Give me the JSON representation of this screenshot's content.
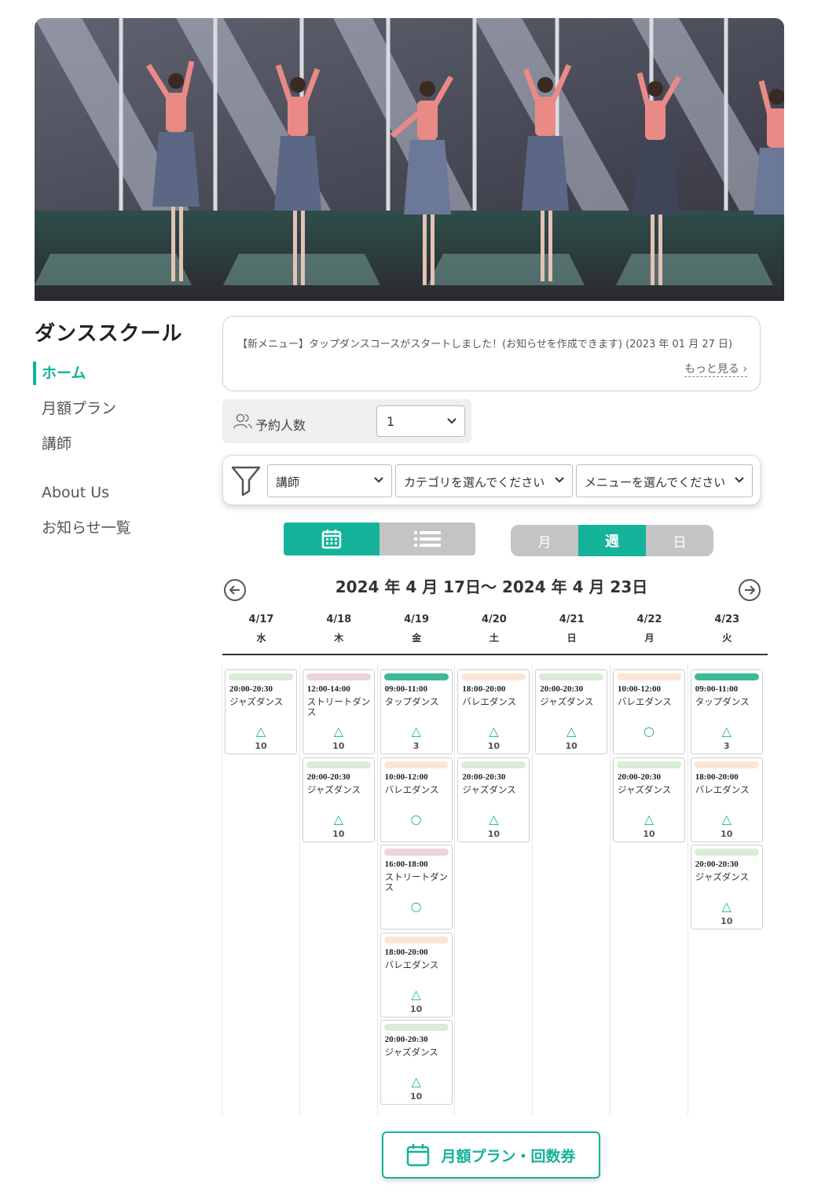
{
  "brand": {
    "title": "ダンススクール"
  },
  "nav": {
    "items": [
      {
        "label": "ホーム"
      },
      {
        "label": "月額プラン"
      },
      {
        "label": "講師"
      },
      {
        "label": "About Us"
      },
      {
        "label": "お知らせ一覧"
      }
    ]
  },
  "notice": {
    "text": "【新メニュー】タップダンスコースがスタートしました！(お知らせを作成できます) (2023 年 01 月 27 日)",
    "more_label": "もっと見る"
  },
  "booking": {
    "people_label": "予約人数",
    "people_value": "1"
  },
  "filters": {
    "instructor": "講師",
    "category": "カテゴリを選んでください",
    "menu": "メニューを選んでください"
  },
  "range_toggle": {
    "month": "月",
    "week": "週",
    "day": "日",
    "selected": "週"
  },
  "week": {
    "title": "2024 年 4 月 17日〜 2024 年 4 月 23日",
    "days": [
      {
        "date": "4/17",
        "weekday": "水",
        "lessons": [
          {
            "time": "20:00-20:30",
            "name": "ジャズダンス",
            "status": "△",
            "count": "10",
            "color": "#d8ecd6"
          }
        ]
      },
      {
        "date": "4/18",
        "weekday": "木",
        "lessons": [
          {
            "time": "12:00-14:00",
            "name": "ストリートダンス",
            "status": "△",
            "count": "10",
            "color": "#ecd3dd"
          },
          {
            "time": "20:00-20:30",
            "name": "ジャズダンス",
            "status": "△",
            "count": "10",
            "color": "#d8ecd6"
          }
        ]
      },
      {
        "date": "4/19",
        "weekday": "金",
        "lessons": [
          {
            "time": "09:00-11:00",
            "name": "タップダンス",
            "status": "△",
            "count": "3",
            "color": "#3cba96"
          },
          {
            "time": "10:00-12:00",
            "name": "バレエダンス",
            "status": "○",
            "count": "",
            "color": "#fde5d6"
          },
          {
            "time": "16:00-18:00",
            "name": "ストリートダンス",
            "status": "○",
            "count": "",
            "color": "#ecd3dd"
          },
          {
            "time": "18:00-20:00",
            "name": "バレエダンス",
            "status": "△",
            "count": "10",
            "color": "#fde5d6"
          },
          {
            "time": "20:00-20:30",
            "name": "ジャズダンス",
            "status": "△",
            "count": "10",
            "color": "#d8ecd6"
          }
        ]
      },
      {
        "date": "4/20",
        "weekday": "土",
        "lessons": [
          {
            "time": "18:00-20:00",
            "name": "バレエダンス",
            "status": "△",
            "count": "10",
            "color": "#fde5d6"
          },
          {
            "time": "20:00-20:30",
            "name": "ジャズダンス",
            "status": "△",
            "count": "10",
            "color": "#d8ecd6"
          }
        ]
      },
      {
        "date": "4/21",
        "weekday": "日",
        "lessons": [
          {
            "time": "20:00-20:30",
            "name": "ジャズダンス",
            "status": "△",
            "count": "10",
            "color": "#d8ecd6"
          }
        ]
      },
      {
        "date": "4/22",
        "weekday": "月",
        "lessons": [
          {
            "time": "10:00-12:00",
            "name": "バレエダンス",
            "status": "○",
            "count": "",
            "color": "#fde5d6"
          },
          {
            "time": "20:00-20:30",
            "name": "ジャズダンス",
            "status": "△",
            "count": "10",
            "color": "#d8ecd6"
          }
        ]
      },
      {
        "date": "4/23",
        "weekday": "火",
        "lessons": [
          {
            "time": "09:00-11:00",
            "name": "タップダンス",
            "status": "△",
            "count": "3",
            "color": "#3cba96"
          },
          {
            "time": "18:00-20:00",
            "name": "バレエダンス",
            "status": "△",
            "count": "10",
            "color": "#fde5d6"
          },
          {
            "time": "20:00-20:30",
            "name": "ジャズダンス",
            "status": "△",
            "count": "10",
            "color": "#d8ecd6"
          }
        ]
      }
    ]
  },
  "cta": {
    "label": "月額プラン・回数券"
  },
  "colors": {
    "accent": "#14b39a",
    "toggle_off": "#c4c4c4"
  }
}
